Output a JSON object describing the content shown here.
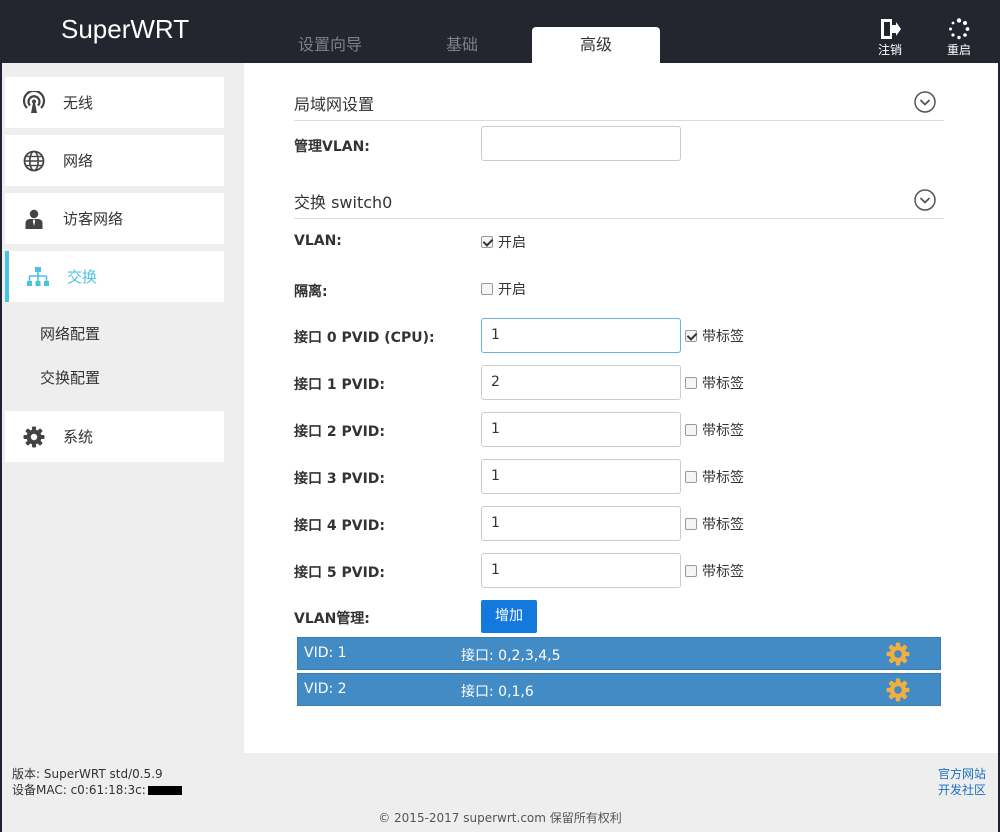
{
  "header": {
    "brand": "SuperWRT",
    "tabs": [
      {
        "label": "设置向导"
      },
      {
        "label": "基础"
      },
      {
        "label": "高级"
      }
    ],
    "logout_label": "注销",
    "reboot_label": "重启"
  },
  "sidebar": {
    "items": [
      {
        "label": "无线",
        "icon": "wireless-icon"
      },
      {
        "label": "网络",
        "icon": "globe-icon"
      },
      {
        "label": "访客网络",
        "icon": "guest-user-icon"
      },
      {
        "label": "交换",
        "icon": "switch-network-icon"
      },
      {
        "label": "系统",
        "icon": "gear-icon"
      }
    ],
    "subitems": [
      {
        "label": "网络配置"
      },
      {
        "label": "交换配置"
      }
    ]
  },
  "lan": {
    "title": "局域网设置",
    "mgmt_vlan_label": "管理VLAN:",
    "mgmt_vlan_value": ""
  },
  "switch": {
    "title": "交换 switch0",
    "vlan_label": "VLAN:",
    "vlan_enable_label": "开启",
    "vlan_enabled": true,
    "isolate_label": "隔离:",
    "isolate_enable_label": "开启",
    "isolate_enabled": false,
    "tagged_label": "带标签",
    "ports": [
      {
        "label": "接口 0 PVID (CPU):",
        "pvid": "1",
        "tagged": true
      },
      {
        "label": "接口 1 PVID:",
        "pvid": "2",
        "tagged": false
      },
      {
        "label": "接口 2 PVID:",
        "pvid": "1",
        "tagged": false
      },
      {
        "label": "接口 3 PVID:",
        "pvid": "1",
        "tagged": false
      },
      {
        "label": "接口 4 PVID:",
        "pvid": "1",
        "tagged": false
      },
      {
        "label": "接口 5 PVID:",
        "pvid": "1",
        "tagged": false
      }
    ],
    "vlan_mgmt_label": "VLAN管理:",
    "add_label": "增加",
    "vlans": [
      {
        "vid": "VID: 1",
        "ports": "接口: 0,2,3,4,5"
      },
      {
        "vid": "VID: 2",
        "ports": "接口: 0,1,6"
      }
    ]
  },
  "footer": {
    "version": "版本: SuperWRT std/0.5.9",
    "mac": "设备MAC: c0:61:18:3c:",
    "link_official": "官方网站",
    "link_community": "开发社区",
    "copyright": "© 2015-2017 superwrt.com 保留所有权利"
  },
  "colors": {
    "header_bg": "#23252f",
    "accent": "#4bc2e0",
    "vlan_row": "#428bc4",
    "add_button": "#1479dc",
    "gear": "#f0b040"
  }
}
